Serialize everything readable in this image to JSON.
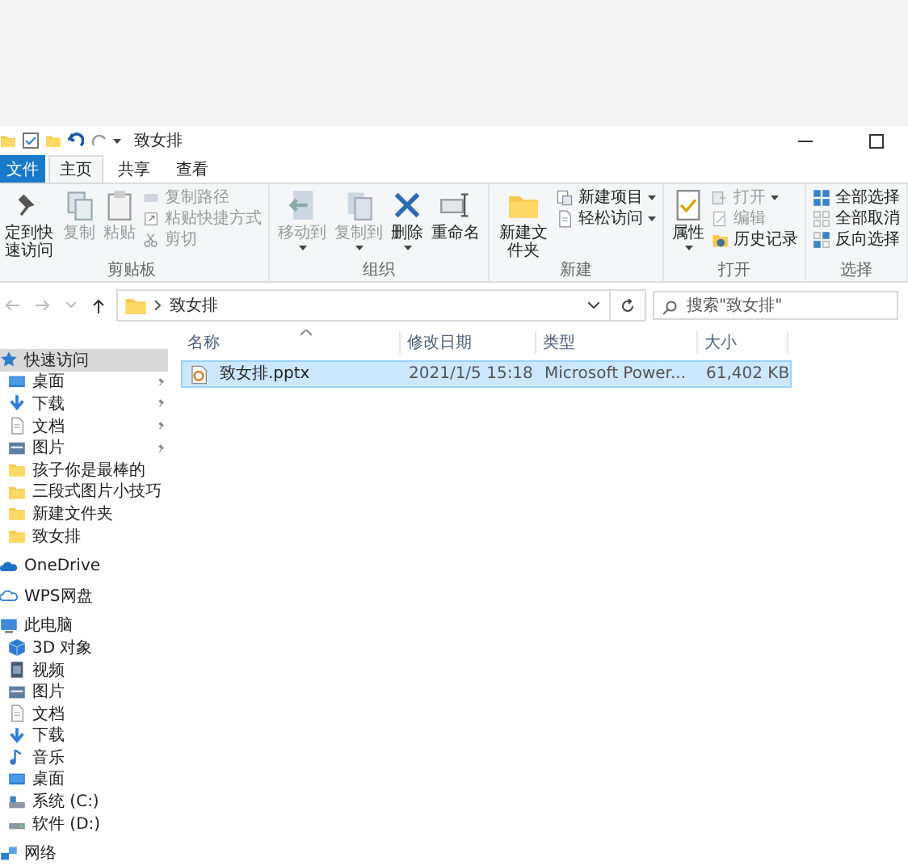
{
  "window": {
    "title": "致女排"
  },
  "ribbon_tabs": [
    {
      "label": "文件",
      "kind": "file",
      "selected": false
    },
    {
      "label": "主页",
      "kind": "tab",
      "selected": true
    },
    {
      "label": "共享",
      "kind": "tab",
      "selected": false
    },
    {
      "label": "查看",
      "kind": "tab",
      "selected": false
    }
  ],
  "ribbon_groups": [
    {
      "label": "剪贴板",
      "commands": [
        {
          "label": "定到快速访问",
          "kind": "large",
          "disabled": false,
          "menu": false
        },
        {
          "label": "复制",
          "kind": "large",
          "disabled": true,
          "menu": false
        },
        {
          "label": "粘贴",
          "kind": "large",
          "disabled": true,
          "menu": false
        },
        {
          "label": "复制路径",
          "kind": "small",
          "disabled": true,
          "menu": false
        },
        {
          "label": "粘贴快捷方式",
          "kind": "small",
          "disabled": true,
          "menu": false
        },
        {
          "label": "剪切",
          "kind": "small",
          "disabled": true,
          "menu": false
        }
      ]
    },
    {
      "label": "组织",
      "commands": [
        {
          "label": "移动到",
          "kind": "large",
          "disabled": true,
          "menu": true
        },
        {
          "label": "复制到",
          "kind": "large",
          "disabled": true,
          "menu": true
        },
        {
          "label": "删除",
          "kind": "large",
          "disabled": false,
          "menu": true
        },
        {
          "label": "重命名",
          "kind": "large",
          "disabled": false,
          "menu": false
        }
      ]
    },
    {
      "label": "新建",
      "commands": [
        {
          "label": "新建文件夹",
          "kind": "large",
          "disabled": false,
          "menu": false
        },
        {
          "label": "新建项目",
          "kind": "small",
          "disabled": false,
          "menu": true
        },
        {
          "label": "轻松访问",
          "kind": "small",
          "disabled": false,
          "menu": true
        }
      ]
    },
    {
      "label": "打开",
      "commands": [
        {
          "label": "属性",
          "kind": "large",
          "disabled": false,
          "menu": true
        },
        {
          "label": "打开",
          "kind": "small",
          "disabled": true,
          "menu": true
        },
        {
          "label": "编辑",
          "kind": "small",
          "disabled": true,
          "menu": false
        },
        {
          "label": "历史记录",
          "kind": "small",
          "disabled": false,
          "menu": false
        }
      ]
    },
    {
      "label": "选择",
      "commands": [
        {
          "label": "全部选择",
          "kind": "small",
          "disabled": false,
          "menu": false
        },
        {
          "label": "全部取消",
          "kind": "small",
          "disabled": false,
          "menu": false
        },
        {
          "label": "反向选择",
          "kind": "small",
          "disabled": false,
          "menu": false
        }
      ]
    }
  ],
  "address": {
    "path": [
      "致女排"
    ],
    "search_placeholder": "搜索\"致女排\""
  },
  "columns": [
    "名称",
    "修改日期",
    "类型",
    "大小"
  ],
  "files": [
    {
      "name": "致女排.pptx",
      "modified": "2021/1/5 15:18",
      "type": "Microsoft Power...",
      "size": "61,402 KB",
      "selected": true
    }
  ],
  "nav": [
    {
      "label": "快速访问",
      "selected": true,
      "children": [
        {
          "label": "桌面",
          "pinned": true
        },
        {
          "label": "下载",
          "pinned": true
        },
        {
          "label": "文档",
          "pinned": true
        },
        {
          "label": "图片",
          "pinned": true
        },
        {
          "label": "孩子你是最棒的",
          "pinned": false
        },
        {
          "label": "三段式图片小技巧",
          "pinned": false
        },
        {
          "label": "新建文件夹",
          "pinned": false
        },
        {
          "label": "致女排",
          "pinned": false
        }
      ]
    },
    {
      "label": "OneDrive",
      "selected": false
    },
    {
      "label": "WPS网盘",
      "selected": false
    },
    {
      "label": "此电脑",
      "selected": false,
      "children": [
        {
          "label": "3D 对象",
          "pinned": false
        },
        {
          "label": "视频",
          "pinned": false
        },
        {
          "label": "图片",
          "pinned": false
        },
        {
          "label": "文档",
          "pinned": false
        },
        {
          "label": "下载",
          "pinned": false
        },
        {
          "label": "音乐",
          "pinned": false
        },
        {
          "label": "桌面",
          "pinned": false
        },
        {
          "label": "系统 (C:)",
          "pinned": false
        },
        {
          "label": "软件 (D:)",
          "pinned": false
        }
      ]
    },
    {
      "label": "网络",
      "selected": false
    }
  ]
}
